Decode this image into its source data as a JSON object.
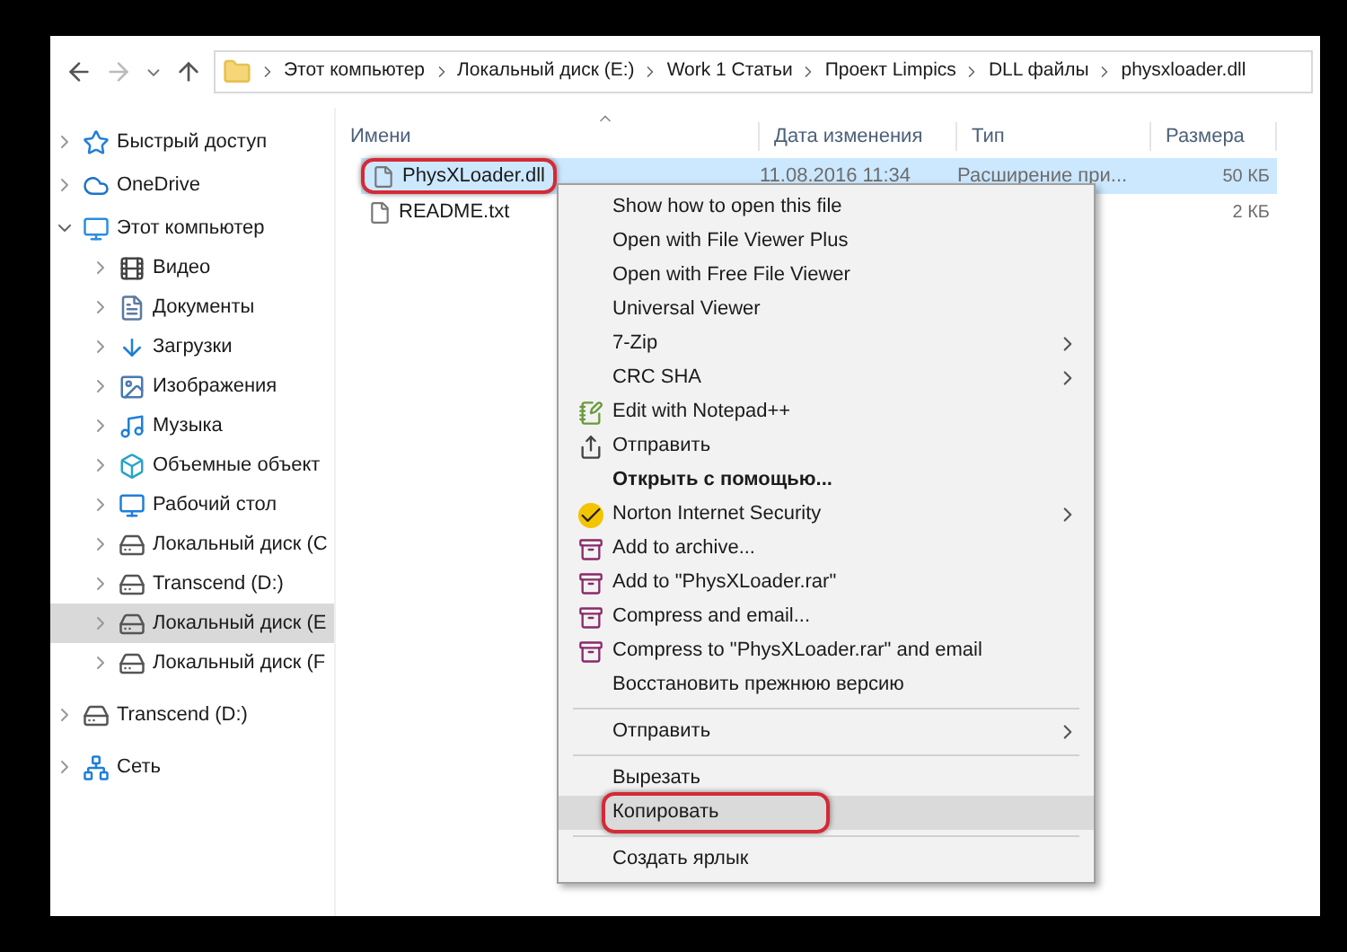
{
  "breadcrumb": [
    "Этот компьютер",
    "Локальный диск (E:)",
    "Work 1 Статьи",
    "Проект Limpics",
    "DLL файлы",
    "physxloader.dll"
  ],
  "columns": [
    "Имени",
    "Дата изменения",
    "Тип",
    "Размера"
  ],
  "sidebar": [
    {
      "label": "Быстрый доступ",
      "expanded": false,
      "selected": false
    },
    {
      "label": "OneDrive",
      "expanded": false,
      "selected": false
    },
    {
      "label": "Этот компьютер",
      "expanded": true,
      "selected": false,
      "children": [
        {
          "label": "Видео",
          "expanded": false,
          "selected": false
        },
        {
          "label": "Документы",
          "expanded": false,
          "selected": false
        },
        {
          "label": "Загрузки",
          "expanded": false,
          "selected": false
        },
        {
          "label": "Изображения",
          "expanded": false,
          "selected": false
        },
        {
          "label": "Музыка",
          "expanded": false,
          "selected": false
        },
        {
          "label": "Объемные объект",
          "expanded": false,
          "selected": false
        },
        {
          "label": "Рабочий стол",
          "expanded": false,
          "selected": false
        },
        {
          "label": "Локальный диск (C",
          "expanded": false,
          "selected": false
        },
        {
          "label": "Transcend (D:)",
          "expanded": false,
          "selected": false
        },
        {
          "label": "Локальный диск (E",
          "expanded": false,
          "selected": true
        },
        {
          "label": "Локальный диск (F",
          "expanded": false,
          "selected": false
        }
      ]
    },
    {
      "label": "Transcend (D:)",
      "expanded": false,
      "selected": false
    },
    {
      "label": "Сеть",
      "expanded": false,
      "selected": false
    }
  ],
  "files": [
    {
      "name": "PhysXLoader.dll",
      "date": "11.08.2016 11:34",
      "type": "Расширение при...",
      "size": "50 КБ",
      "selected": true,
      "callout": true
    },
    {
      "name": "README.txt",
      "size": "2 КБ",
      "selected": false,
      "callout": false
    }
  ],
  "context_menu": [
    {
      "kind": "item",
      "label": "Show how to open this file",
      "submenu": false,
      "bold": false,
      "selected": false,
      "callout": false
    },
    {
      "kind": "item",
      "label": "Open with File Viewer Plus",
      "submenu": false,
      "bold": false,
      "selected": false,
      "callout": false
    },
    {
      "kind": "item",
      "label": "Open with Free File Viewer",
      "submenu": false,
      "bold": false,
      "selected": false,
      "callout": false
    },
    {
      "kind": "item",
      "label": "Universal Viewer",
      "submenu": false,
      "bold": false,
      "selected": false,
      "callout": false
    },
    {
      "kind": "item",
      "label": "7-Zip",
      "submenu": true,
      "bold": false,
      "selected": false,
      "callout": false
    },
    {
      "kind": "item",
      "label": "CRC SHA",
      "submenu": true,
      "bold": false,
      "selected": false,
      "callout": false
    },
    {
      "kind": "item",
      "label": "Edit with Notepad++",
      "submenu": false,
      "bold": false,
      "selected": false,
      "callout": false
    },
    {
      "kind": "item",
      "label": "Отправить",
      "submenu": false,
      "bold": false,
      "selected": false,
      "callout": false
    },
    {
      "kind": "item",
      "label": "Открыть с помощью...",
      "submenu": false,
      "bold": true,
      "selected": false,
      "callout": false
    },
    {
      "kind": "item",
      "label": "Norton Internet Security",
      "submenu": true,
      "bold": false,
      "selected": false,
      "callout": false
    },
    {
      "kind": "item",
      "label": "Add to archive...",
      "submenu": false,
      "bold": false,
      "selected": false,
      "callout": false
    },
    {
      "kind": "item",
      "label": "Add to \"PhysXLoader.rar\"",
      "submenu": false,
      "bold": false,
      "selected": false,
      "callout": false
    },
    {
      "kind": "item",
      "label": "Compress and email...",
      "submenu": false,
      "bold": false,
      "selected": false,
      "callout": false
    },
    {
      "kind": "item",
      "label": "Compress to \"PhysXLoader.rar\" and email",
      "submenu": false,
      "bold": false,
      "selected": false,
      "callout": false
    },
    {
      "kind": "item",
      "label": "Восстановить прежнюю версию",
      "submenu": false,
      "bold": false,
      "selected": false,
      "callout": false
    },
    {
      "kind": "separator"
    },
    {
      "kind": "item",
      "label": "Отправить",
      "submenu": true,
      "bold": false,
      "selected": false,
      "callout": false
    },
    {
      "kind": "separator"
    },
    {
      "kind": "item",
      "label": "Вырезать",
      "submenu": false,
      "bold": false,
      "selected": false,
      "callout": false
    },
    {
      "kind": "item",
      "label": "Копировать",
      "submenu": false,
      "bold": false,
      "selected": true,
      "callout": true
    },
    {
      "kind": "separator"
    },
    {
      "kind": "item",
      "label": "Создать ярлык",
      "submenu": false,
      "bold": false,
      "selected": false,
      "callout": false
    }
  ]
}
